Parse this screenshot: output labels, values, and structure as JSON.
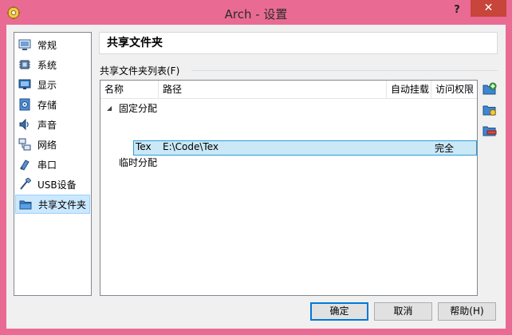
{
  "window": {
    "title": "Arch - 设置",
    "help_glyph": "?",
    "close_glyph": "✕"
  },
  "sidebar": {
    "items": [
      {
        "label": "常规",
        "icon": "general-icon"
      },
      {
        "label": "系统",
        "icon": "system-chip-icon"
      },
      {
        "label": "显示",
        "icon": "display-icon"
      },
      {
        "label": "存储",
        "icon": "storage-icon"
      },
      {
        "label": "声音",
        "icon": "audio-icon"
      },
      {
        "label": "网络",
        "icon": "network-icon"
      },
      {
        "label": "串口",
        "icon": "serial-port-icon"
      },
      {
        "label": "USB设备",
        "icon": "usb-icon"
      },
      {
        "label": "共享文件夹",
        "icon": "shared-folder-icon",
        "selected": true
      }
    ]
  },
  "page": {
    "title": "共享文件夹",
    "list_caption": "共享文件夹列表(F)"
  },
  "tree": {
    "columns": {
      "name": "名称",
      "path": "路径",
      "auto_mount": "自动挂载",
      "access": "访问权限"
    },
    "groups": {
      "fixed": "固定分配",
      "temporary": "临时分配"
    },
    "rows": [
      {
        "name": "Tex",
        "path": "E:\\Code\\Tex",
        "auto_mount": "",
        "access": "完全"
      }
    ],
    "expander_glyph": "◢"
  },
  "tools": [
    "add-shared-folder-icon",
    "edit-shared-folder-icon",
    "remove-shared-folder-icon"
  ],
  "buttons": {
    "ok": "确定",
    "cancel": "取消",
    "help": "帮助(H)"
  },
  "colors": {
    "frame": "#e96b93",
    "selection": "#cce8ff",
    "row_selection_border": "#26a0da",
    "close_button": "#c7453a"
  }
}
